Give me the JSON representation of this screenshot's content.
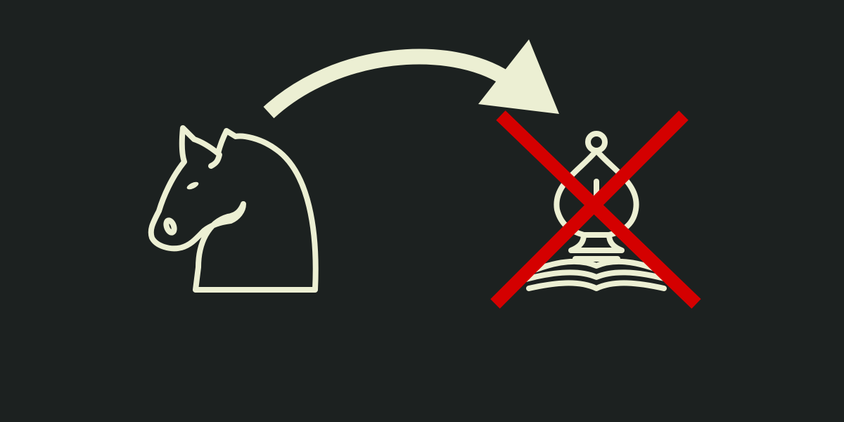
{
  "colors": {
    "background": "#1c2120",
    "piece": "#ecefd3",
    "cross": "#d40000"
  },
  "diagram": {
    "attacker": {
      "icon": "chess-knight-icon"
    },
    "move": {
      "icon": "curved-arrow-icon"
    },
    "target": {
      "icon": "chess-bishop-icon",
      "status": "captured",
      "status_icon": "red-cross-icon"
    }
  }
}
